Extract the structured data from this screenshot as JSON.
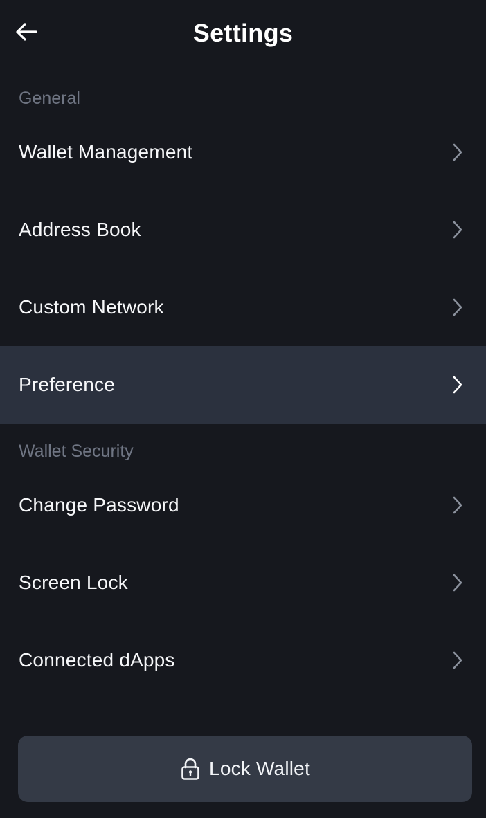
{
  "header": {
    "title": "Settings",
    "back_icon": "arrow-left-icon"
  },
  "sections": [
    {
      "label": "General",
      "items": [
        {
          "label": "Wallet Management",
          "icon": "chevron-right-icon"
        },
        {
          "label": "Address Book",
          "icon": "chevron-right-icon"
        },
        {
          "label": "Custom Network",
          "icon": "chevron-right-icon"
        },
        {
          "label": "Preference",
          "icon": "chevron-right-icon",
          "highlighted": true
        }
      ]
    },
    {
      "label": "Wallet Security",
      "items": [
        {
          "label": "Change Password",
          "icon": "chevron-right-icon"
        },
        {
          "label": "Screen Lock",
          "icon": "chevron-right-icon"
        },
        {
          "label": "Connected dApps",
          "icon": "chevron-right-icon"
        }
      ]
    }
  ],
  "lock_button": {
    "label": "Lock Wallet",
    "icon": "lock-icon"
  },
  "colors": {
    "background": "#16181e",
    "highlight_row": "#2b313e",
    "section_label": "#6f7583",
    "button_bg": "#343a46",
    "text": "#ffffff"
  }
}
